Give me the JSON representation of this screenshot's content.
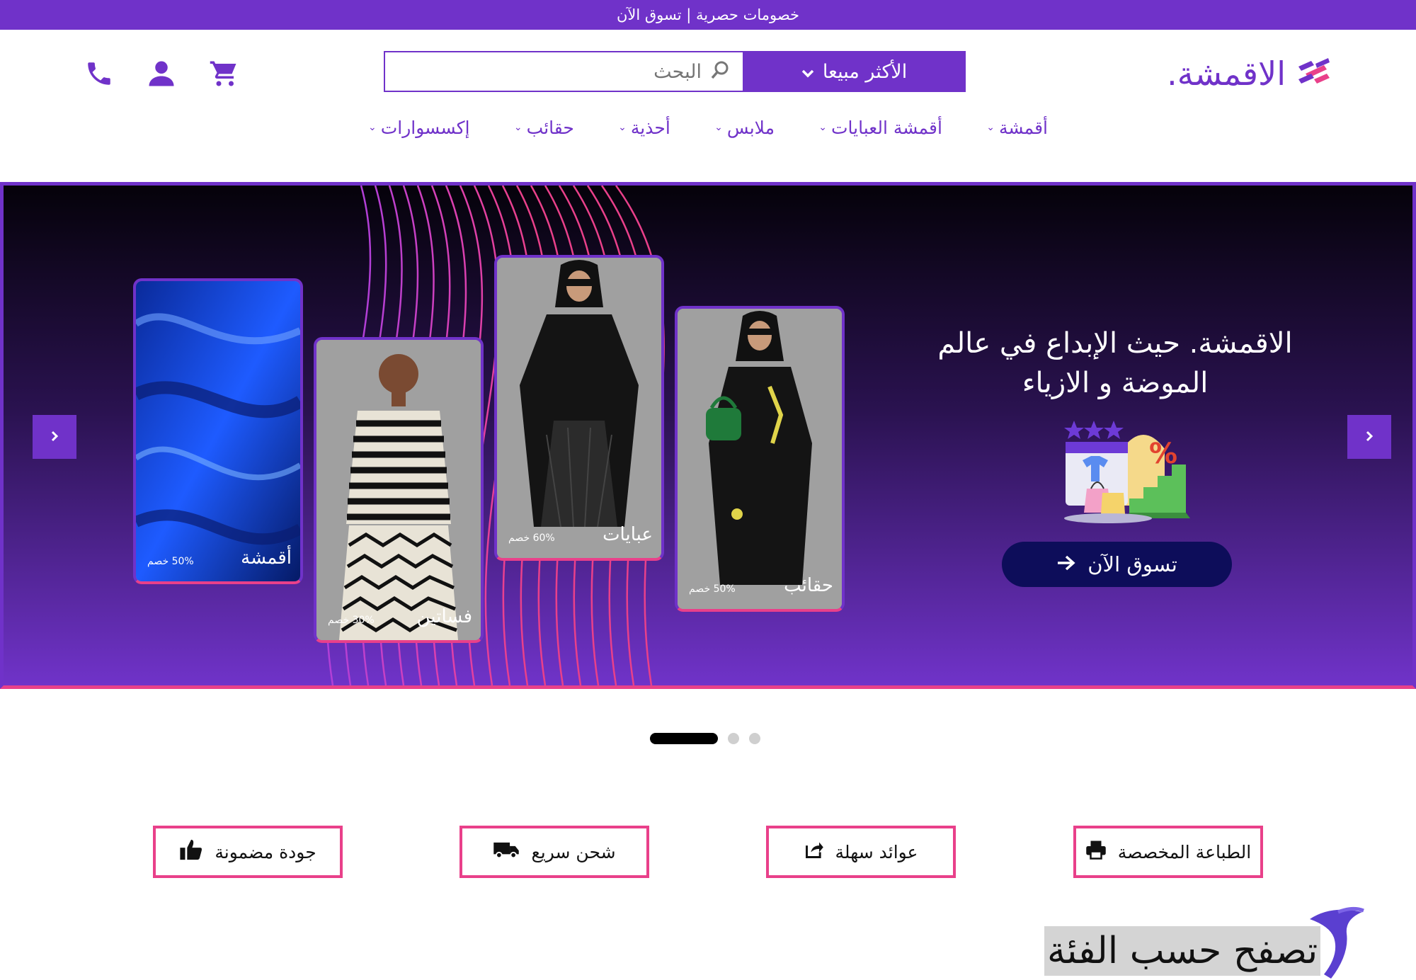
{
  "topbar": {
    "text": "خصومات حصرية | تسوق الآن"
  },
  "logo": {
    "text": "الاقمشة."
  },
  "search": {
    "bestseller_label": "الأكثر مبيعا",
    "placeholder": "البحث"
  },
  "nav": {
    "items": [
      {
        "label": "أقمشة"
      },
      {
        "label": "أقمشة العبايات"
      },
      {
        "label": "ملابس"
      },
      {
        "label": "أحذية"
      },
      {
        "label": "حقائب"
      },
      {
        "label": "إكسسوارات"
      }
    ]
  },
  "hero": {
    "headline": "الاقمشة. حيث الإبداع في عالم الموضة و الازياء",
    "cta": "تسوق الآن",
    "cards": [
      {
        "name": "أقمشة",
        "discount": "50% خصم"
      },
      {
        "name": "فساتين",
        "discount": "30% خصم"
      },
      {
        "name": "عبايات",
        "discount": "60% خصم"
      },
      {
        "name": "حقائب",
        "discount": "50% خصم"
      }
    ]
  },
  "features": [
    {
      "label": "الطباعة المخصصة",
      "icon": "printer-icon"
    },
    {
      "label": "عوائد سهلة",
      "icon": "share-icon"
    },
    {
      "label": "شحن سريع",
      "icon": "truck-icon"
    },
    {
      "label": "جودة مضمونة",
      "icon": "thumbs-up-icon"
    }
  ],
  "category_heading": "تصفح حسب الفئة",
  "colors": {
    "brand": "#7032c9",
    "accent": "#e9408a",
    "cta": "#0d0d5a"
  }
}
